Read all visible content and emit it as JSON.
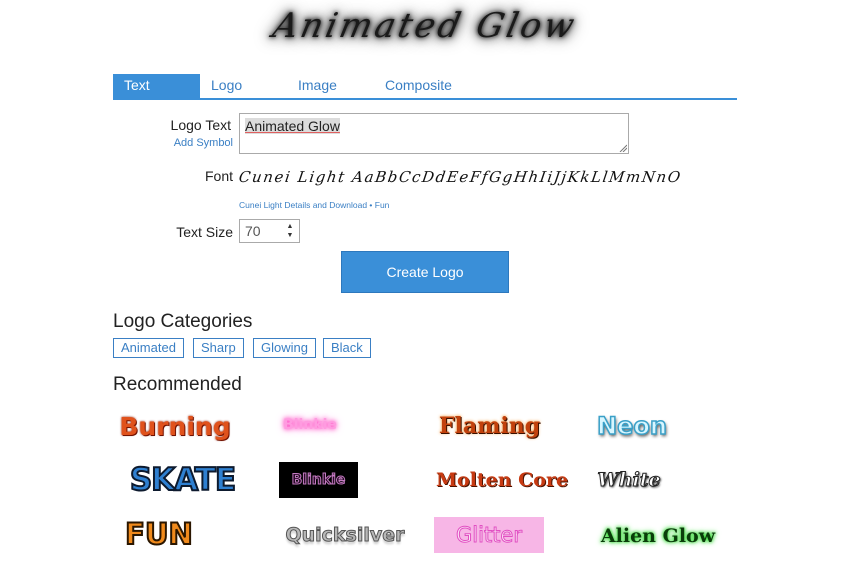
{
  "header": {
    "logo_text": "Animated Glow"
  },
  "tabs": [
    {
      "label": "Text",
      "active": true
    },
    {
      "label": "Logo",
      "active": false
    },
    {
      "label": "Image",
      "active": false
    },
    {
      "label": "Composite",
      "active": false
    }
  ],
  "form": {
    "logo_text_label": "Logo Text",
    "add_symbol_link": "Add Symbol",
    "logo_text_value": "Animated Glow",
    "font_label": "Font",
    "font_preview": "Cunei Light AaBbCcDdEeFfGgHhIiJjKkLlMmNnO",
    "font_details_link": "Cunei Light Details and Download",
    "font_separator": " • ",
    "font_category_link": "Fun",
    "text_size_label": "Text Size",
    "text_size_value": "70",
    "create_button": "Create Logo"
  },
  "categories": {
    "heading": "Logo Categories",
    "items": [
      "Animated",
      "Sharp",
      "Glowing",
      "Black"
    ]
  },
  "recommended": {
    "heading": "Recommended",
    "items": [
      {
        "label": "Burning",
        "color": "#e0521c"
      },
      {
        "label": "Blinkie",
        "color": "#ff7fd6"
      },
      {
        "label": "Flaming",
        "color": "#c2410c"
      },
      {
        "label": "Neon",
        "color": "#c9f2ff"
      },
      {
        "label": "SKATE",
        "color": "#2f80d1"
      },
      {
        "label": "Blinkie",
        "color": "#7a2a6e"
      },
      {
        "label": "Molten Core",
        "color": "#c73a12"
      },
      {
        "label": "White",
        "color": "#ffffff"
      },
      {
        "label": "FUN",
        "color": "#f08a1c"
      },
      {
        "label": "Quicksilver",
        "color": "#9a9a9a"
      },
      {
        "label": "Glitter",
        "color": "#e14fc2"
      },
      {
        "label": "Alien Glow",
        "color": "#1a8a1a"
      }
    ]
  },
  "colors": {
    "accent": "#3a8fd8",
    "link": "#3a7fc4"
  }
}
